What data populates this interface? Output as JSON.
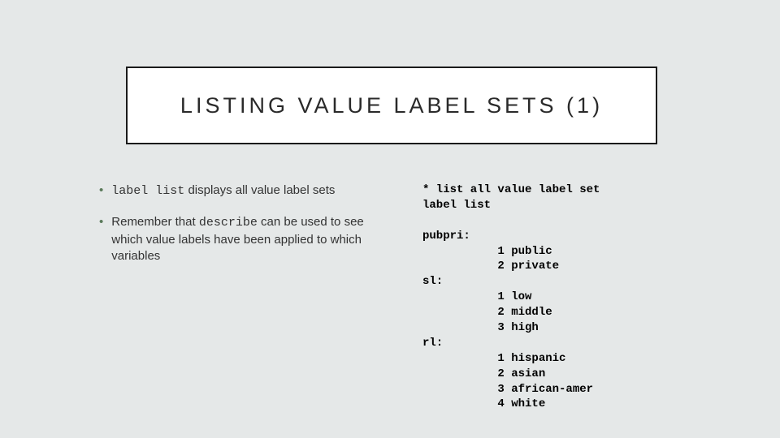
{
  "title": "LISTING VALUE LABEL SETS (1)",
  "bullets": {
    "b1": {
      "cmd": "label list",
      "rest": " displays all value label sets"
    },
    "b2": {
      "pre": "Remember that ",
      "cmd": "describe",
      "rest": " can be used to see which value labels have been applied to which variables"
    }
  },
  "code": {
    "l1": "* list all value label set",
    "l2": "label list",
    "l3": "",
    "l4": "pubpri:",
    "l5": "           1 public",
    "l6": "           2 private",
    "l7": "sl:",
    "l8": "           1 low",
    "l9": "           2 middle",
    "l10": "           3 high",
    "l11": "rl:",
    "l12": "           1 hispanic",
    "l13": "           2 asian",
    "l14": "           3 african-amer",
    "l15": "           4 white"
  }
}
